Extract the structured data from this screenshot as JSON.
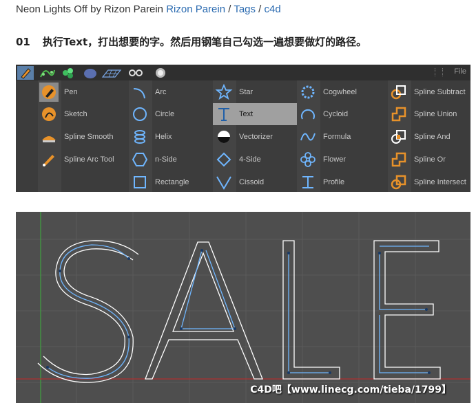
{
  "header": {
    "prefix": "Neon Lights Off by Rizon Parein ",
    "author_link": "Rizon Parein",
    "sep1": " / ",
    "tags_link": "Tags",
    "sep2": " / ",
    "c4d_link": "c4d"
  },
  "step": {
    "number": "01",
    "text": "执行Text，打出想要的字。然后用钢笔自己勾选一遍想要做灯的路径。"
  },
  "toolbar": {
    "icons": [
      "pen-tool-icon",
      "spline-network-icon",
      "flower-group-icon",
      "sphere-icon",
      "grid-plane-icon",
      "eyes-icon",
      "light-bulb-icon"
    ],
    "file_label": "File"
  },
  "menu": {
    "col1": [
      {
        "label": "Pen",
        "icon": "pen-icon",
        "selected": false
      },
      {
        "label": "Sketch",
        "icon": "sketch-icon"
      },
      {
        "label": "Spline Smooth",
        "icon": "spline-smooth-icon"
      },
      {
        "label": "Spline Arc Tool",
        "icon": "spline-arc-tool-icon"
      }
    ],
    "col2": [
      {
        "label": "Arc",
        "icon": "arc-icon"
      },
      {
        "label": "Circle",
        "icon": "circle-icon"
      },
      {
        "label": "Helix",
        "icon": "helix-icon"
      },
      {
        "label": "n-Side",
        "icon": "n-side-icon"
      },
      {
        "label": "Rectangle",
        "icon": "rectangle-icon"
      }
    ],
    "col3": [
      {
        "label": "Star",
        "icon": "star-icon"
      },
      {
        "label": "Text",
        "icon": "text-icon",
        "selected": true
      },
      {
        "label": "Vectorizer",
        "icon": "vectorizer-icon"
      },
      {
        "label": "4-Side",
        "icon": "four-side-icon"
      },
      {
        "label": "Cissoid",
        "icon": "cissoid-icon"
      }
    ],
    "col4": [
      {
        "label": "Cogwheel",
        "icon": "cogwheel-icon"
      },
      {
        "label": "Cycloid",
        "icon": "cycloid-icon"
      },
      {
        "label": "Formula",
        "icon": "formula-icon"
      },
      {
        "label": "Flower",
        "icon": "flower-icon"
      },
      {
        "label": "Profile",
        "icon": "profile-icon"
      }
    ],
    "col5": [
      {
        "label": "Spline Subtract",
        "icon": "spline-subtract-icon"
      },
      {
        "label": "Spline Union",
        "icon": "spline-union-icon"
      },
      {
        "label": "Spline And",
        "icon": "spline-and-icon"
      },
      {
        "label": "Spline Or",
        "icon": "spline-or-icon"
      },
      {
        "label": "Spline Intersect",
        "icon": "spline-intersect-icon"
      }
    ]
  },
  "viewport": {
    "text_object": "SALE",
    "watermark": "C4D吧【www.linecg.com/tieba/1799】"
  },
  "colors": {
    "accent_blue": "#6fb6ff",
    "selection": "#a0a0a0",
    "panel_bg": "#3c3c3c",
    "orange_icon": "#e8922a"
  }
}
